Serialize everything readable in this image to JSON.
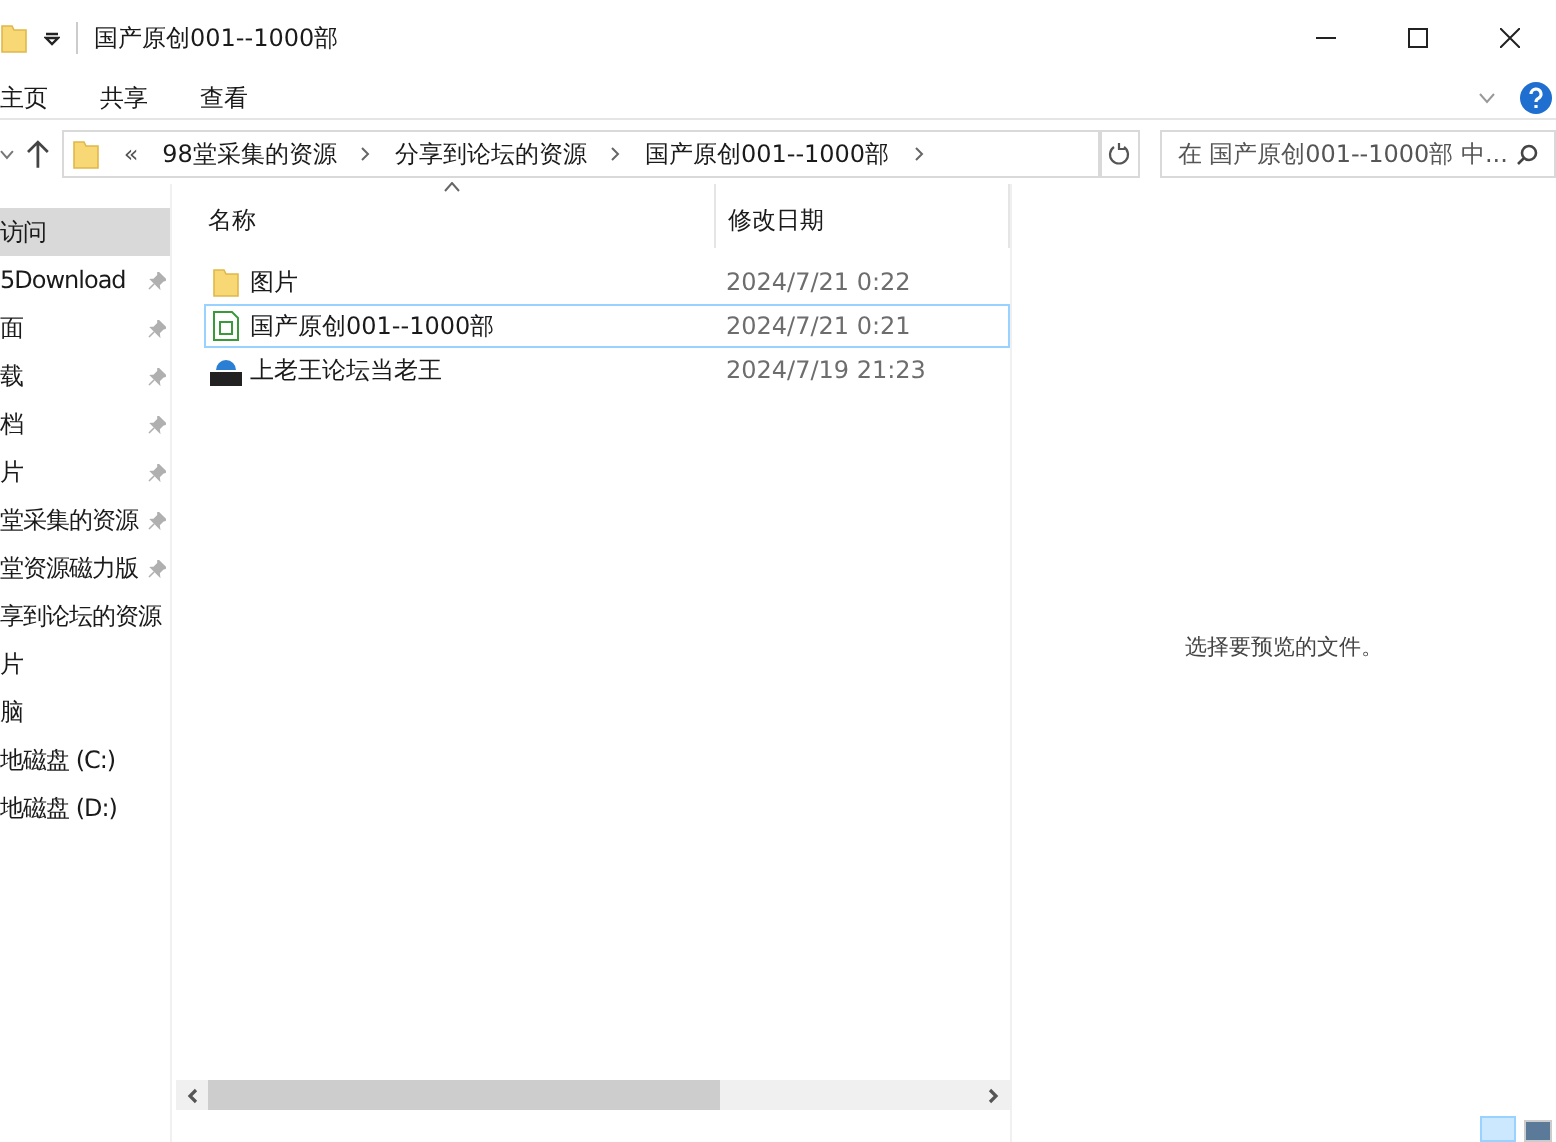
{
  "window": {
    "title": "国产原创001--1000部"
  },
  "ribbon_tabs": [
    {
      "label": "主页"
    },
    {
      "label": "共享"
    },
    {
      "label": "查看"
    }
  ],
  "address_bar": {
    "overflow": "«",
    "crumbs": [
      "98堂采集的资源",
      "分享到论坛的资源",
      "国产原创001--1000部"
    ]
  },
  "search": {
    "placeholder": "在 国产原创001--1000部 中..."
  },
  "sidebar": {
    "items": [
      {
        "label": "访问",
        "pinned": false,
        "selected": true
      },
      {
        "label": "5Download",
        "pinned": true,
        "selected": false
      },
      {
        "label": "面",
        "pinned": true,
        "selected": false
      },
      {
        "label": "载",
        "pinned": true,
        "selected": false
      },
      {
        "label": "档",
        "pinned": true,
        "selected": false
      },
      {
        "label": "片",
        "pinned": true,
        "selected": false
      },
      {
        "label": "堂采集的资源",
        "pinned": true,
        "selected": false
      },
      {
        "label": "堂资源磁力版",
        "pinned": true,
        "selected": false
      },
      {
        "label": "享到论坛的资源",
        "pinned": false,
        "selected": false
      },
      {
        "label": "片",
        "pinned": false,
        "selected": false
      },
      {
        "label": "脑",
        "pinned": false,
        "selected": false
      },
      {
        "label": "地磁盘 (C:)",
        "pinned": false,
        "selected": false
      },
      {
        "label": "地磁盘 (D:)",
        "pinned": false,
        "selected": false
      }
    ]
  },
  "table": {
    "columns": [
      "名称",
      "修改日期"
    ],
    "rows": [
      {
        "kind": "folder",
        "name": "图片",
        "modified": "2024/7/21 0:22",
        "focused": false
      },
      {
        "kind": "sheet",
        "name": "国产原创001--1000部",
        "modified": "2024/7/21 0:21",
        "focused": true
      },
      {
        "kind": "zip",
        "name": "上老王论坛当老王",
        "modified": "2024/7/19 21:23",
        "focused": false
      }
    ]
  },
  "preview": {
    "message": "选择要预览的文件。"
  }
}
